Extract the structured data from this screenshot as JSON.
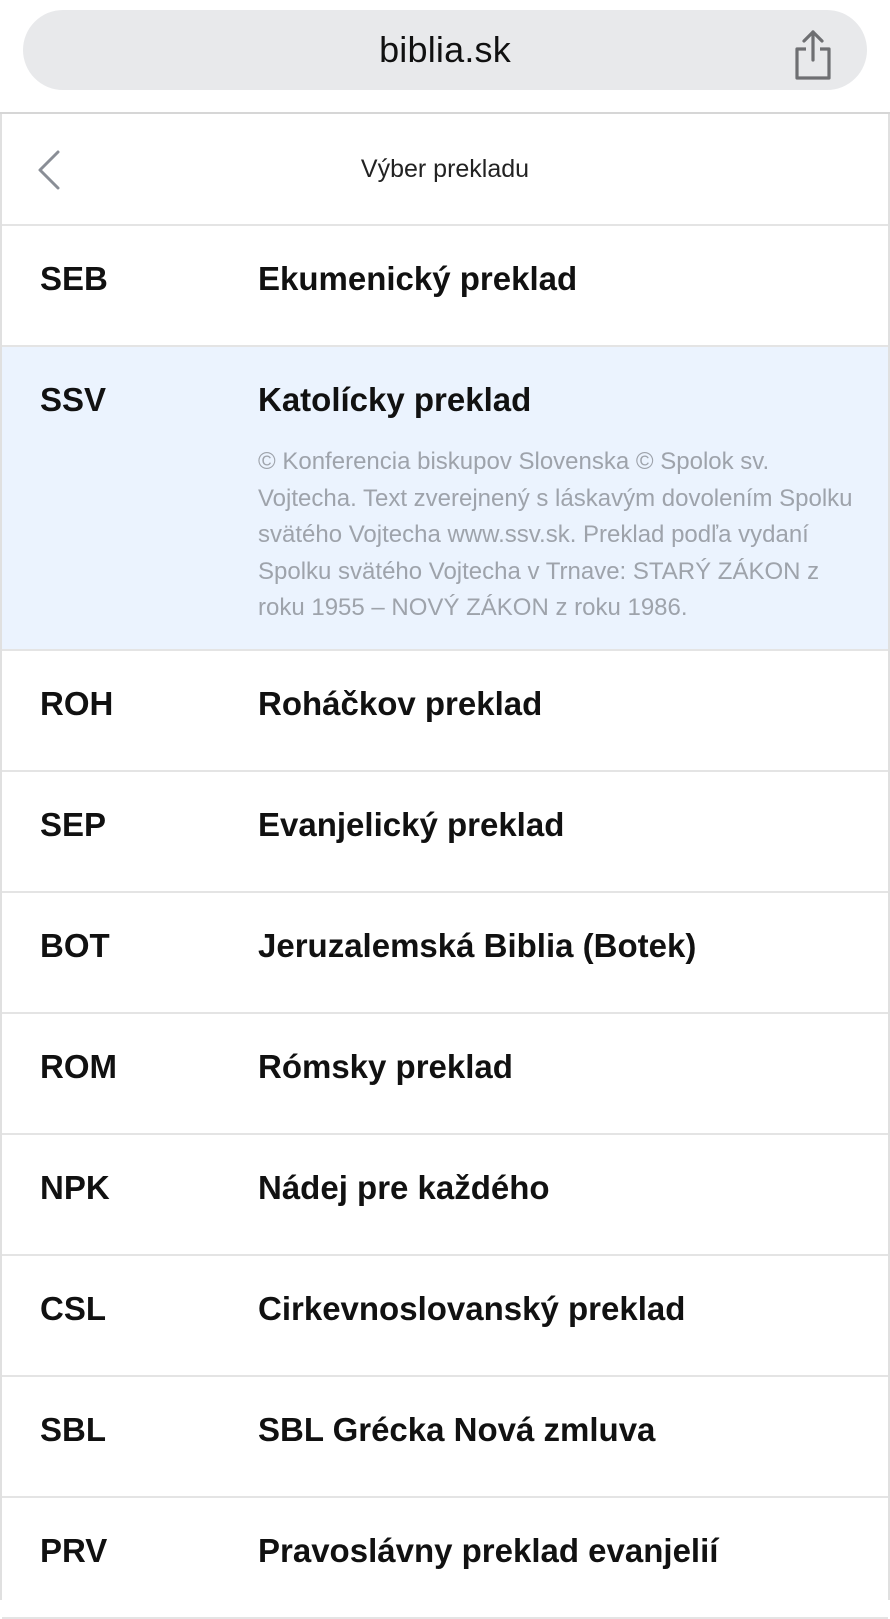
{
  "browser": {
    "url": "biblia.sk",
    "share_icon": "share-icon"
  },
  "header": {
    "back_icon": "chevron-left-icon",
    "title": "Výber prekladu"
  },
  "translations": [
    {
      "code": "SEB",
      "name": "Ekumenický preklad"
    },
    {
      "code": "SSV",
      "name": "Katolícky preklad",
      "selected": true,
      "description": "© Konferencia biskupov Slovenska © Spolok sv. Vojtecha. Text zverejnený s láskavým dovolením Spolku svätého Vojtecha www.ssv.sk. Preklad podľa vydaní Spolku svätého Vojtecha v Trnave: STARÝ ZÁKON z roku 1955 – NOVÝ ZÁKON z roku 1986."
    },
    {
      "code": "ROH",
      "name": "Roháčkov preklad"
    },
    {
      "code": "SEP",
      "name": "Evanjelický preklad"
    },
    {
      "code": "BOT",
      "name": "Jeruzalemská Biblia (Botek)"
    },
    {
      "code": "ROM",
      "name": "Rómsky preklad"
    },
    {
      "code": "NPK",
      "name": "Nádej pre každého"
    },
    {
      "code": "CSL",
      "name": "Cirkevnoslovanský preklad"
    },
    {
      "code": "SBL",
      "name": "SBL Grécka Nová zmluva"
    },
    {
      "code": "PRV",
      "name": "Pravoslávny preklad evanjelií"
    }
  ],
  "colors": {
    "selected_bg": "#ebf3fe",
    "description_text": "#9ea3ab",
    "url_bar_bg": "#e8e9eb"
  }
}
